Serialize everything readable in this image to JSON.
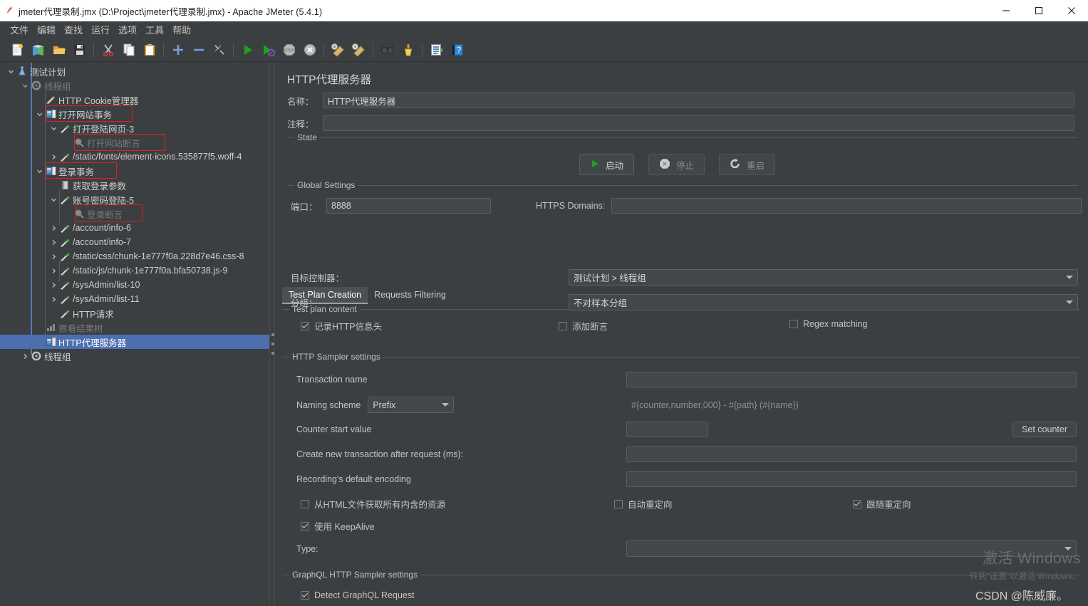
{
  "window": {
    "title": "jmeter代理录制.jmx (D:\\Project\\jmeter代理录制.jmx) - Apache JMeter (5.4.1)",
    "icon": "jmeter-feather-icon",
    "minimize": "minimize-icon",
    "maximize": "maximize-icon",
    "close": "close-icon"
  },
  "menubar": {
    "items": [
      {
        "label": "文件"
      },
      {
        "label": "编辑"
      },
      {
        "label": "查找"
      },
      {
        "label": "运行"
      },
      {
        "label": "选项"
      },
      {
        "label": "工具"
      },
      {
        "label": "帮助"
      }
    ]
  },
  "toolbar": {
    "groups": [
      [
        "new-test-plan-icon",
        "open-templates-icon",
        "open-file-icon",
        "save-icon"
      ],
      [
        "cut-icon",
        "copy-icon",
        "paste-icon"
      ],
      [
        "expand-all-icon",
        "collapse-all-icon",
        "toggle-icon"
      ],
      [
        "start-icon",
        "start-no-timers-icon",
        "stop-icon",
        "shutdown-icon"
      ],
      [
        "clear-icon",
        "clear-all-icon"
      ],
      [
        "search-icon",
        "search-reset-icon"
      ],
      [
        "function-helper-icon",
        "help-icon"
      ]
    ]
  },
  "tree": {
    "nodes": [
      {
        "label": "测试计划",
        "icon": "test-plan-icon",
        "depth": 0,
        "twisty": "down",
        "state": "normal"
      },
      {
        "label": "线程组",
        "icon": "thread-group-icon",
        "depth": 1,
        "twisty": "down",
        "state": "dim"
      },
      {
        "label": "HTTP Cookie管理器",
        "icon": "cookie-manager-icon",
        "depth": 2,
        "twisty": "none",
        "state": "normal"
      },
      {
        "label": "打开网站事务",
        "icon": "transaction-controller-icon",
        "depth": 2,
        "twisty": "down",
        "state": "normal"
      },
      {
        "label": "打开登陆网页-3",
        "icon": "http-sampler-icon",
        "depth": 3,
        "twisty": "down",
        "state": "normal"
      },
      {
        "label": "打开网站断言",
        "icon": "assertion-icon",
        "depth": 4,
        "twisty": "none",
        "state": "dim"
      },
      {
        "label": "/static/fonts/element-icons.535877f5.woff-4",
        "icon": "http-sampler-icon",
        "depth": 3,
        "twisty": "right",
        "state": "normal"
      },
      {
        "label": "登录事务",
        "icon": "transaction-controller-icon",
        "depth": 2,
        "twisty": "down",
        "state": "normal"
      },
      {
        "label": "获取登录参数",
        "icon": "post-processor-icon",
        "depth": 3,
        "twisty": "none",
        "state": "normal"
      },
      {
        "label": "账号密码登陆-5",
        "icon": "http-sampler-icon",
        "depth": 3,
        "twisty": "down",
        "state": "normal"
      },
      {
        "label": "登录断言",
        "icon": "assertion-icon",
        "depth": 4,
        "twisty": "none",
        "state": "dim"
      },
      {
        "label": "/account/info-6",
        "icon": "http-sampler-icon",
        "depth": 3,
        "twisty": "right",
        "state": "normal"
      },
      {
        "label": "/account/info-7",
        "icon": "http-sampler-icon",
        "depth": 3,
        "twisty": "right",
        "state": "normal"
      },
      {
        "label": "/static/css/chunk-1e777f0a.228d7e46.css-8",
        "icon": "http-sampler-icon",
        "depth": 3,
        "twisty": "right",
        "state": "normal"
      },
      {
        "label": "/static/js/chunk-1e777f0a.bfa50738.js-9",
        "icon": "http-sampler-icon",
        "depth": 3,
        "twisty": "right",
        "state": "normal"
      },
      {
        "label": "/sysAdmin/list-10",
        "icon": "http-sampler-icon",
        "depth": 3,
        "twisty": "right",
        "state": "normal"
      },
      {
        "label": "/sysAdmin/list-11",
        "icon": "http-sampler-icon",
        "depth": 3,
        "twisty": "right",
        "state": "normal"
      },
      {
        "label": "HTTP请求",
        "icon": "http-sampler-icon",
        "depth": 3,
        "twisty": "none",
        "state": "normal"
      },
      {
        "label": "察看结果树",
        "icon": "view-results-tree-icon",
        "depth": 2,
        "twisty": "none",
        "state": "dim"
      },
      {
        "label": "HTTP代理服务器",
        "icon": "http-proxy-icon",
        "depth": 2,
        "twisty": "none",
        "state": "selected"
      },
      {
        "label": "线程组",
        "icon": "thread-group-icon",
        "depth": 1,
        "twisty": "right",
        "state": "normal"
      }
    ],
    "annotation_color": "#e02020"
  },
  "panel": {
    "title": "HTTP代理服务器",
    "name_label": "名称：",
    "name_value": "HTTP代理服务器",
    "comment_label": "注释：",
    "comment_value": "",
    "state_group": "State",
    "buttons": {
      "start": "启动",
      "stop": "停止",
      "restart": "重启"
    },
    "global_group": "Global Settings",
    "port_label": "端口：",
    "port_value": "8888",
    "https_domains_label": "HTTPS Domains:",
    "https_domains_value": "",
    "tabs": [
      {
        "label": "Test Plan Creation",
        "active": true
      },
      {
        "label": "Requests Filtering",
        "active": false
      }
    ],
    "test_plan_content_group": "Test plan content",
    "target_controller_label": "目标控制器：",
    "target_controller_value": "测试计划 > 线程组",
    "grouping_label": "分组：",
    "grouping_value": "不对样本分组",
    "checkboxes_row1": [
      {
        "label": "记录HTTP信息头",
        "checked": true
      },
      {
        "label": "添加断言",
        "checked": false
      },
      {
        "label": "Regex matching",
        "checked": false
      }
    ],
    "http_sampler_group": "HTTP Sampler settings",
    "transaction_name_label": "Transaction name",
    "transaction_name_value": "",
    "naming_scheme_label": "Naming scheme",
    "naming_scheme_value": "Prefix",
    "naming_pattern_placeholder": "#{counter,number,000} - #{path} (#{name})",
    "counter_start_label": "Counter start value",
    "counter_start_value": "",
    "set_counter_button": "Set counter",
    "create_new_transaction_label": "Create new transaction after request (ms):",
    "create_new_transaction_value": "",
    "recording_encoding_label": "Recording's default encoding",
    "recording_encoding_value": "",
    "checkboxes_row2": [
      {
        "label": "从HTML文件获取所有内含的资源",
        "checked": false
      },
      {
        "label": "自动重定向",
        "checked": false
      },
      {
        "label": "跟随重定向",
        "checked": true
      }
    ],
    "keepalive": {
      "label": "使用 KeepAlive",
      "checked": true
    },
    "type_label": "Type:",
    "type_value": "",
    "graphql_group": "GraphQL HTTP Sampler settings",
    "detect_graphql": {
      "label": "Detect GraphQL Request",
      "checked": true
    }
  },
  "watermark": {
    "line1": "激活 Windows",
    "line2": "转到\"设置\"以激活 Windows。",
    "credit": "CSDN @陈威廉。"
  },
  "colors": {
    "background": "#3c3f41",
    "selection": "#4d6fb0",
    "titlebar": "#ffffff",
    "accent_green": "#2fa82f",
    "annotation_red": "#e02020"
  }
}
